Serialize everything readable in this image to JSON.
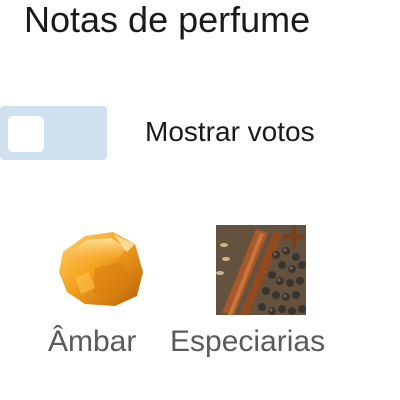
{
  "page": {
    "title": "Notas de perfume"
  },
  "votes_toggle": {
    "label": "Mostrar votos",
    "enabled": false,
    "track_color": "#cfe0ef"
  },
  "notes": [
    {
      "name": "Âmbar",
      "icon": "amber-stone-image"
    },
    {
      "name": "Especiarias",
      "icon": "spices-image"
    }
  ]
}
